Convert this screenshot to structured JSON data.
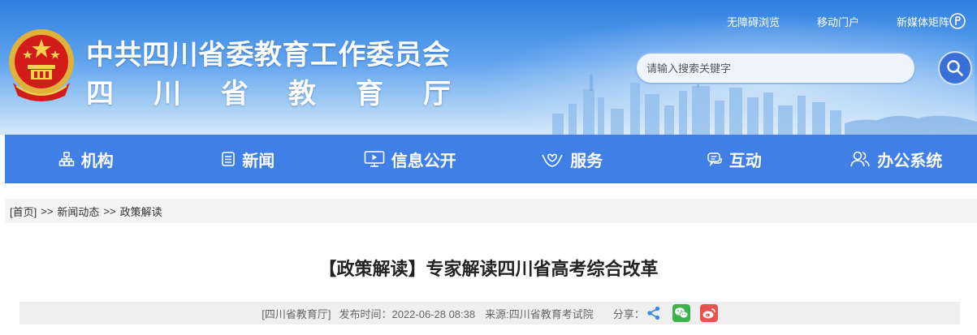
{
  "header": {
    "org_name": "中共四川省委教育工作委员会",
    "dept_name": "四川省教育厅",
    "top_links": [
      "无障碍浏览",
      "移动门户",
      "新媒体矩阵"
    ],
    "search": {
      "placeholder": "请输入搜索关键字",
      "icon": "search-icon"
    },
    "emblem": "national-emblem"
  },
  "nav": {
    "items": [
      {
        "label": "机构",
        "icon": "org-chart-icon"
      },
      {
        "label": "新闻",
        "icon": "newspaper-icon"
      },
      {
        "label": "信息公开",
        "icon": "monitor-icon"
      },
      {
        "label": "服务",
        "icon": "hands-heart-icon"
      },
      {
        "label": "互动",
        "icon": "chat-icon"
      },
      {
        "label": "办公系统",
        "icon": "users-icon"
      }
    ],
    "color": "#3f7fe6"
  },
  "breadcrumb": {
    "items": [
      "[首页]",
      "新闻动态",
      "政策解读"
    ],
    "separator": ">>"
  },
  "article": {
    "title": "【政策解读】专家解读四川省高考综合改革",
    "meta": {
      "publisher": "[四川省教育厅]",
      "date": "发布时间：2022-06-28 08:38",
      "source": "来源:四川省教育考试院",
      "share_label": "分享："
    },
    "share_icons": [
      "share-icon",
      "wechat-icon",
      "weibo-icon"
    ]
  }
}
